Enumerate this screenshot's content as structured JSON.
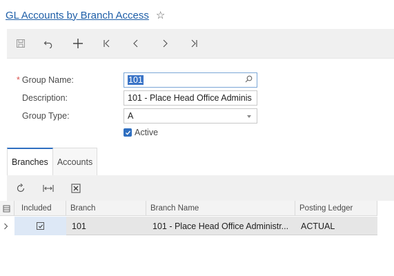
{
  "page": {
    "title": "GL Accounts by Branch Access"
  },
  "form": {
    "group_name_label": "Group Name:",
    "group_name_value": "101",
    "description_label": "Description:",
    "description_value": "101 - Place Head Office Adminis",
    "group_type_label": "Group Type:",
    "group_type_value": "A",
    "active_label": "Active",
    "active_checked": true
  },
  "tabs": [
    {
      "label": "Branches",
      "active": true
    },
    {
      "label": "Accounts",
      "active": false
    }
  ],
  "grid": {
    "columns": [
      "Included",
      "Branch",
      "Branch Name",
      "Posting Ledger"
    ],
    "rows": [
      {
        "included": true,
        "branch": "101",
        "branch_name": "101 - Place Head Office Administr...",
        "posting_ledger": "ACTUAL"
      }
    ]
  },
  "colors": {
    "link": "#1f5fa8",
    "accent": "#2f6fc0",
    "required": "#d9534f"
  }
}
